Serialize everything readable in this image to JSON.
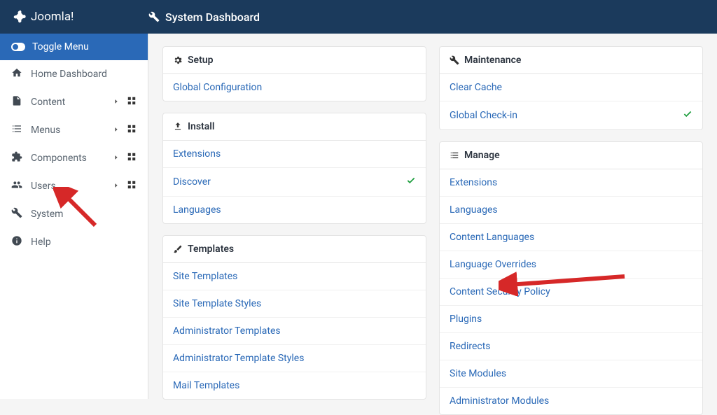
{
  "brand": "Joomla!",
  "page_title": "System Dashboard",
  "toggle_label": "Toggle Menu",
  "sidebar": {
    "items": [
      {
        "label": "Home Dashboard",
        "icon": "home",
        "expand": false,
        "grid": false
      },
      {
        "label": "Content",
        "icon": "file",
        "expand": true,
        "grid": true
      },
      {
        "label": "Menus",
        "icon": "list",
        "expand": true,
        "grid": true
      },
      {
        "label": "Components",
        "icon": "puzzle",
        "expand": true,
        "grid": true
      },
      {
        "label": "Users",
        "icon": "users",
        "expand": true,
        "grid": true
      },
      {
        "label": "System",
        "icon": "wrench",
        "expand": false,
        "grid": false
      },
      {
        "label": "Help",
        "icon": "info",
        "expand": false,
        "grid": false
      }
    ]
  },
  "panels": {
    "setup": {
      "title": "Setup",
      "items": [
        "Global Configuration"
      ]
    },
    "install": {
      "title": "Install",
      "items": [
        "Extensions",
        "Discover",
        "Languages"
      ],
      "checked": [
        1
      ]
    },
    "templates": {
      "title": "Templates",
      "items": [
        "Site Templates",
        "Site Template Styles",
        "Administrator Templates",
        "Administrator Template Styles",
        "Mail Templates"
      ]
    },
    "maintenance": {
      "title": "Maintenance",
      "items": [
        "Clear Cache",
        "Global Check-in"
      ],
      "checked": [
        1
      ]
    },
    "manage": {
      "title": "Manage",
      "items": [
        "Extensions",
        "Languages",
        "Content Languages",
        "Language Overrides",
        "Content Security Policy",
        "Plugins",
        "Redirects",
        "Site Modules",
        "Administrator Modules"
      ]
    }
  }
}
